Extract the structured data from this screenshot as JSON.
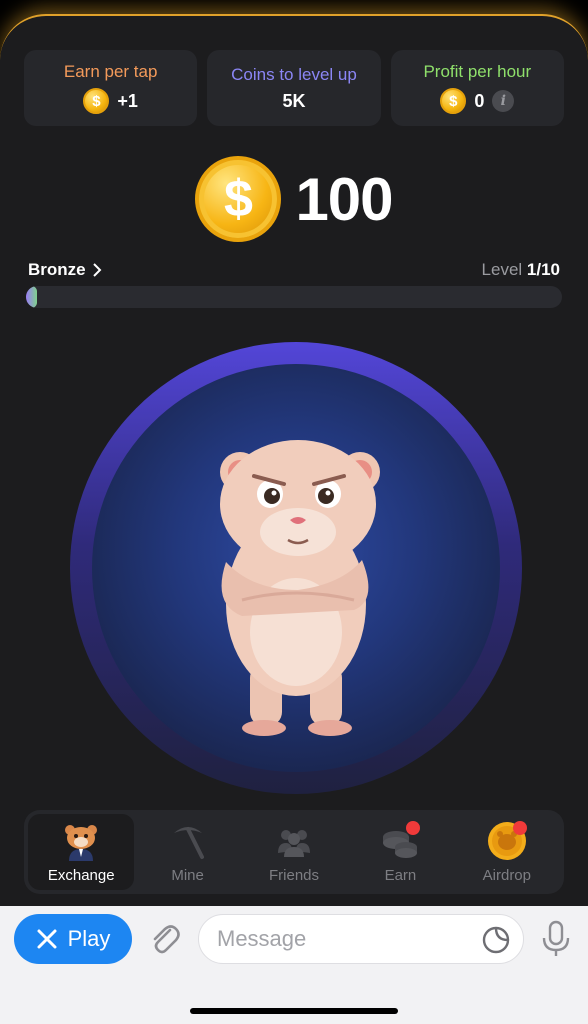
{
  "stats": {
    "earn_per_tap": {
      "label": "Earn per tap",
      "value": "+1",
      "color": "#f39a5a"
    },
    "coins_to_level": {
      "label": "Coins to level up",
      "value": "5K",
      "color": "#8b86f5"
    },
    "profit_per_hour": {
      "label": "Profit per hour",
      "value": "0",
      "color": "#8fe06b"
    }
  },
  "balance": {
    "value": "100",
    "icon": "dollar-coin-icon"
  },
  "league": {
    "name": "Bronze",
    "chevron": ">"
  },
  "level": {
    "prefix": "Level",
    "value": "1/10",
    "progress": 0.02
  },
  "nav": {
    "items": [
      {
        "label": "Exchange",
        "icon": "hamster-ceo-icon",
        "active": true
      },
      {
        "label": "Mine",
        "icon": "pickaxe-icon",
        "active": false
      },
      {
        "label": "Friends",
        "icon": "people-icon",
        "active": false
      },
      {
        "label": "Earn",
        "icon": "coins-stack-icon",
        "active": false,
        "badge": true
      },
      {
        "label": "Airdrop",
        "icon": "hamster-coin-icon",
        "active": false,
        "badge": true
      }
    ]
  },
  "chat": {
    "play_label": "Play",
    "message_placeholder": "Message"
  }
}
